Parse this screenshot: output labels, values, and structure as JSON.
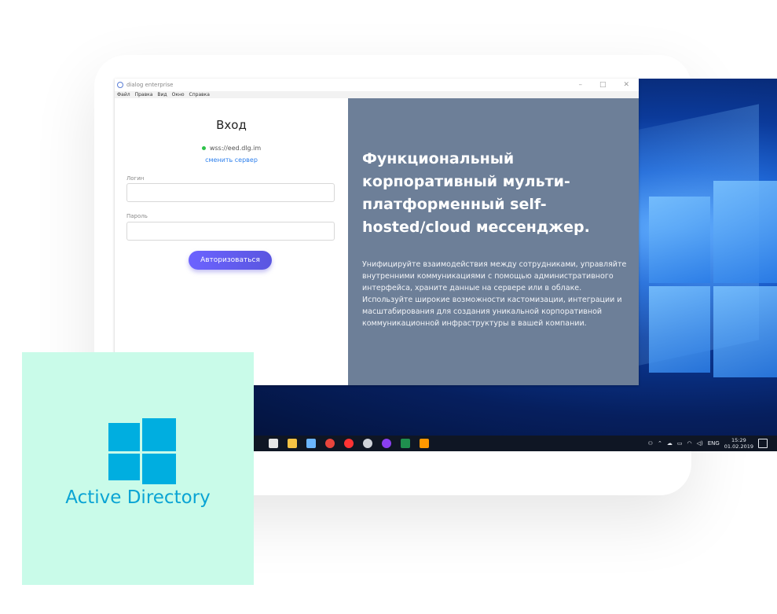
{
  "window": {
    "title": "dialog enterprise",
    "menu": [
      "Файл",
      "Правка",
      "Вид",
      "Окно",
      "Справка"
    ],
    "controls": {
      "minimize": "–",
      "maximize": "□",
      "close": "✕"
    }
  },
  "login": {
    "title": "Вход",
    "server": "wss://eed.dlg.im",
    "change_server": "сменить сервер",
    "login_label": "Логин",
    "login_value": "",
    "password_label": "Пароль",
    "password_value": "",
    "submit": "Авторизоваться",
    "status_color": "#2ec24a",
    "accent": "#6c63ff"
  },
  "promo": {
    "headline": "Функциональный корпоративный мульти-платформенный self-hosted/cloud мессенджер.",
    "body": "Унифицируйте взаимодействия между сотрудниками, управляйте внутренними коммуникациями с помощью административного интерфейса, храните данные на сервере или в облаке. Используйте широкие возможности кастомизации, интеграции и масштабирования для создания уникальной корпоративной коммуникационной инфраструктуры в вашей компании.",
    "background": "#6d7f98"
  },
  "taskbar": {
    "apps": [
      "calculator-icon",
      "file-explorer-icon",
      "notepad-icon",
      "chrome-icon",
      "yandex-browser-icon",
      "obs-icon",
      "dialog-icon",
      "excel-icon",
      "sublime-icon"
    ],
    "lang": "ENG",
    "time": "15:29",
    "date": "01.02.2019"
  },
  "card": {
    "label": "Active Directory",
    "color": "#00aee0",
    "background": "#c9fbe9"
  }
}
